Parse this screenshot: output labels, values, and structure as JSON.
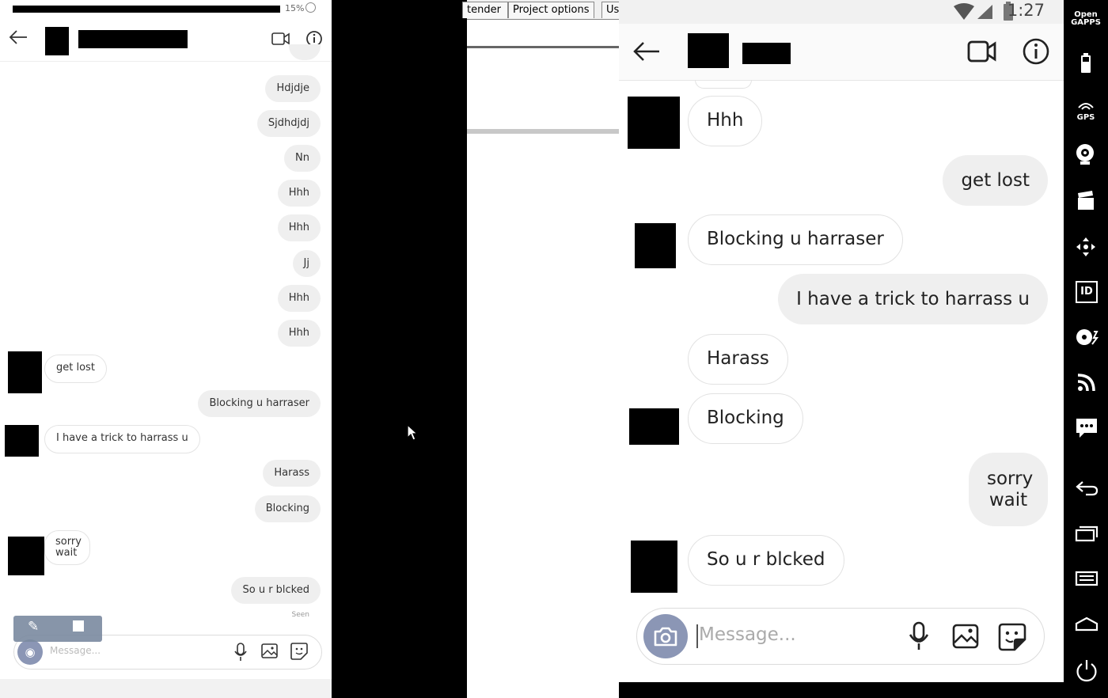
{
  "left_phone": {
    "battery": "15%",
    "messages": [
      {
        "text": "Hdjdje",
        "dir": "out"
      },
      {
        "text": "Sjdhdjdj",
        "dir": "out"
      },
      {
        "text": "Nn",
        "dir": "out"
      },
      {
        "text": "Hhh",
        "dir": "out"
      },
      {
        "text": "Hhh",
        "dir": "out"
      },
      {
        "text": "Jj",
        "dir": "out"
      },
      {
        "text": "Hhh",
        "dir": "out"
      },
      {
        "text": "Hhh",
        "dir": "out"
      },
      {
        "text": "get lost",
        "dir": "in"
      },
      {
        "text": "Blocking u harraser",
        "dir": "out"
      },
      {
        "text": "I have a trick to harrass u",
        "dir": "in"
      },
      {
        "text": "Harass",
        "dir": "out"
      },
      {
        "text": "Blocking",
        "dir": "out"
      },
      {
        "text": "sorry wait",
        "dir": "in"
      },
      {
        "text": "So u r blcked",
        "dir": "out"
      }
    ],
    "seen": "Seen",
    "input_placeholder": "Message..."
  },
  "middle_window": {
    "tabs": [
      "tender",
      "Project options",
      "Us"
    ]
  },
  "right_phone": {
    "time": "1:27",
    "messages": [
      {
        "text": "Hhh",
        "dir": "in"
      },
      {
        "text": "get lost",
        "dir": "out"
      },
      {
        "text": "Blocking u harraser",
        "dir": "in"
      },
      {
        "text": "I have a trick to harrass u",
        "dir": "out"
      },
      {
        "text": "Harass",
        "dir": "in"
      },
      {
        "text": "Blocking",
        "dir": "in"
      },
      {
        "text": "sorry wait",
        "dir": "out"
      },
      {
        "text": "So u r blcked",
        "dir": "in"
      }
    ],
    "input_placeholder": "Message..."
  },
  "sidebar": {
    "open_gapps": "Open GAPPS",
    "gps": "GPS",
    "id": "ID"
  },
  "colors": {
    "camera_button": "#8b96b5",
    "bubble_grey": "#efefef"
  }
}
